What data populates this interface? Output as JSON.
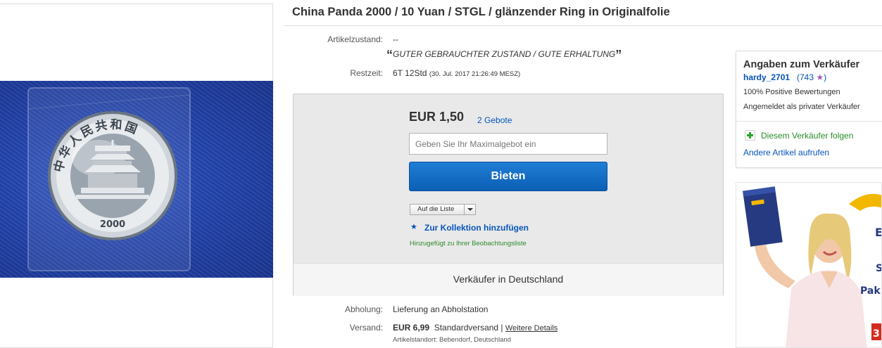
{
  "item": {
    "title": "China Panda 2000 / 10 Yuan / STGL / glänzender Ring in Originalfolie",
    "condition_label": "Artikelzustand:",
    "condition_value": "--",
    "condition_quote_open": "“",
    "condition_quote": "GUTER GEBRAUCHTER ZUSTAND / GUTE ERHALTUNG",
    "condition_quote_close": "”",
    "time_left_label": "Restzeit:",
    "time_left": "6T 12Std",
    "end_time": "(30. Jul. 2017   21:26:49 MESZ)"
  },
  "bid": {
    "price": "EUR 1,50",
    "bids_count": "2 Gebote",
    "max_bid_placeholder": "Geben Sie Ihr Maximalgebot ein",
    "bid_button": "Bieten",
    "watch_list_dropdown": "Auf die Liste",
    "collection_icon": "star-icon",
    "collection_link": "Zur Kollektion hinzufügen",
    "watch_added": "Hinzugefügt zu Ihrer Beobachtungsliste",
    "seller_country": "Verkäufer in Deutschland"
  },
  "shipping": {
    "pickup_label": "Abholung:",
    "pickup_value": "Lieferung an Abholstation",
    "shipping_label": "Versand:",
    "shipping_cost": "EUR 6,99",
    "shipping_method": "Standardversand |",
    "more_details": "Weitere Details",
    "item_location": "Artikelstandort:  Bebendorf, Deutschland"
  },
  "seller": {
    "heading": "Angaben zum Verkäufer",
    "name": "hardy_2701",
    "score_open": "(743",
    "score_icon": "★",
    "score_close": ")",
    "positive": "100% Positive Bewertungen",
    "account_type": "Angemeldet als privater Verkäufer",
    "follow_icon": "plus-icon",
    "follow_link": "Diesem Verkäufer folgen",
    "other_items": "Andere Artikel aufrufen"
  },
  "colors": {
    "link_blue": "#0654ba",
    "button_blue": "#1a73cc",
    "follow_green": "#2b8a2b",
    "star_purple": "#a55bc3"
  },
  "coin": {
    "inscription": "中华人民共和国",
    "year": "2000"
  }
}
